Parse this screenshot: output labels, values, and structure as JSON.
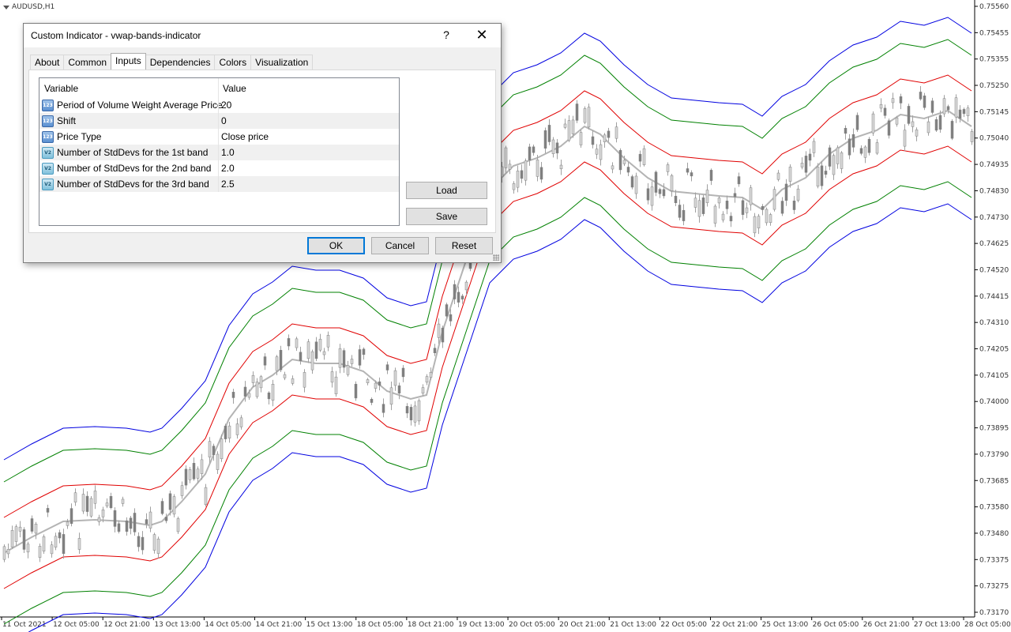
{
  "chart": {
    "symbol": "AUDUSD,H1",
    "price_ticks": [
      "0.75560",
      "0.75455",
      "0.75355",
      "0.75250",
      "0.75145",
      "0.75040",
      "0.74935",
      "0.74830",
      "0.74730",
      "0.74625",
      "0.74520",
      "0.74415",
      "0.74310",
      "0.74205",
      "0.74105",
      "0.74000",
      "0.73895",
      "0.73790",
      "0.73685",
      "0.73580",
      "0.73480",
      "0.73375",
      "0.73275",
      "0.73170"
    ],
    "time_ticks": [
      "11 Oct 2021",
      "12 Oct 05:00",
      "12 Oct 21:00",
      "13 Oct 13:00",
      "14 Oct 05:00",
      "14 Oct 21:00",
      "15 Oct 13:00",
      "18 Oct 05:00",
      "18 Oct 21:00",
      "19 Oct 13:00",
      "20 Oct 05:00",
      "20 Oct 21:00",
      "21 Oct 13:00",
      "22 Oct 05:00",
      "22 Oct 21:00",
      "25 Oct 13:00",
      "26 Oct 05:00",
      "26 Oct 21:00",
      "27 Oct 13:00",
      "28 Oct 05:00"
    ],
    "colors": {
      "outer_band": "#0000e0",
      "middle_band": "#008000",
      "inner_band": "#e00000",
      "vwap": "#b4b4b4",
      "candle": "#808080"
    }
  },
  "dialog": {
    "title": "Custom Indicator - vwap-bands-indicator",
    "help": "?",
    "close": "✕",
    "tabs": [
      "About",
      "Common",
      "Inputs",
      "Dependencies",
      "Colors",
      "Visualization"
    ],
    "active_tab": "Inputs",
    "columns": {
      "variable": "Variable",
      "value": "Value"
    },
    "rows": [
      {
        "icon": "123",
        "name": "Period of Volume Weight Average Price",
        "value": "20"
      },
      {
        "icon": "123",
        "name": "Shift",
        "value": "0"
      },
      {
        "icon": "123",
        "name": "Price Type",
        "value": "Close price"
      },
      {
        "icon": "V2",
        "name": "Number of StdDevs for the 1st band",
        "value": "1.0"
      },
      {
        "icon": "V2",
        "name": "Number of StdDevs for the 2nd band",
        "value": "2.0"
      },
      {
        "icon": "V2",
        "name": "Number of StdDevs for the 3rd band",
        "value": "2.5"
      }
    ],
    "buttons": {
      "load": "Load",
      "save": "Save",
      "ok": "OK",
      "cancel": "Cancel",
      "reset": "Reset"
    }
  }
}
